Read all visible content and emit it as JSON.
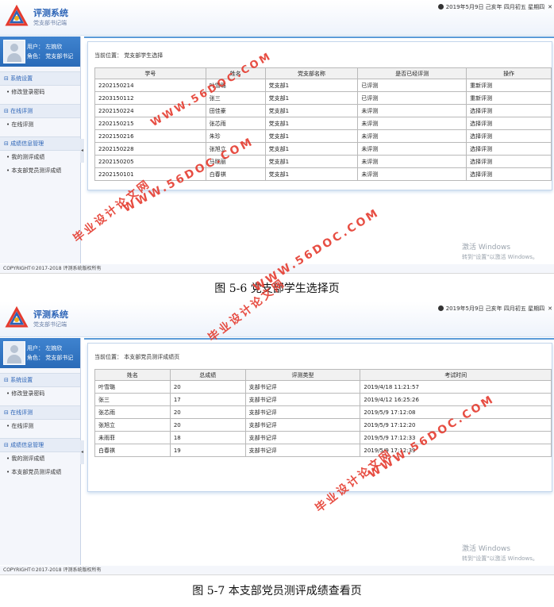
{
  "app": {
    "title": "评测系统",
    "subtitle": "党支部书记端",
    "date": "2019年5月9日 己亥年 四月初五 星期四"
  },
  "sidebar": {
    "user_label": "用户：  左婉欣",
    "role_label": "角色：  党支部书记",
    "groups": [
      {
        "label": "系统设置",
        "items": [
          "修改登录密码"
        ]
      },
      {
        "label": "在线评测",
        "items": [
          "在线评测"
        ]
      },
      {
        "label": "成绩信息管理",
        "items": [
          "我的测评成绩",
          "本支部党员测评成绩"
        ]
      }
    ]
  },
  "screen1": {
    "breadcrumb": "当前位置：  党支部学生选择",
    "columns": [
      "学号",
      "姓名",
      "党支部名称",
      "是否已经评测",
      "操作"
    ],
    "rows": [
      [
        "2202150214",
        "叶雪璐",
        "党支部1",
        "已评测",
        "重新评测"
      ],
      [
        "2203150112",
        "张三",
        "党支部1",
        "已评测",
        "重新评测"
      ],
      [
        "2202150224",
        "田佳豪",
        "党支部1",
        "未评测",
        "选择评测"
      ],
      [
        "2202150215",
        "张芯雨",
        "党支部1",
        "未评测",
        "选择评测"
      ],
      [
        "2202150216",
        "朱珍",
        "党支部1",
        "未评测",
        "选择评测"
      ],
      [
        "2202150228",
        "张旭立",
        "党支部1",
        "未评测",
        "选择评测"
      ],
      [
        "2202150205",
        "马晓丽",
        "党支部1",
        "未评测",
        "选择评测"
      ],
      [
        "2202150101",
        "白春祺",
        "党支部1",
        "未评测",
        "选择评测"
      ]
    ],
    "caption": "图 5-6 党支部学生选择页"
  },
  "screen2": {
    "breadcrumb": "当前位置：  本支部党员测评成绩页",
    "columns": [
      "姓名",
      "总成绩",
      "评测类型",
      "考试时间"
    ],
    "rows": [
      [
        "叶雪璐",
        "20",
        "支部书记评",
        "2019/4/18 11:21:57"
      ],
      [
        "张三",
        "17",
        "支部书记评",
        "2019/4/12 16:25:26"
      ],
      [
        "张芯雨",
        "20",
        "支部书记评",
        "2019/5/9 17:12:08"
      ],
      [
        "张旭立",
        "20",
        "支部书记评",
        "2019/5/9 17:12:20"
      ],
      [
        "未雨菲",
        "18",
        "支部书记评",
        "2019/5/9 17:12:33"
      ],
      [
        "白春祺",
        "19",
        "支部书记评",
        "2019/5/9 17:12:39"
      ]
    ],
    "caption": "图 5-7 本支部党员测评成绩查看页"
  },
  "footer": "COPYRIGHT©2017-2018 评测系统版权所有",
  "activate_windows": {
    "title": "激活 Windows",
    "sub": "转到\"设置\"以激活 Windows。"
  },
  "watermarks": [
    "WWW.56DOC.COM",
    "毕业设计论文网"
  ],
  "colors": {
    "accent": "#2b63b6",
    "watermark": "#e53b2f",
    "header_blue": "#3f83cf"
  }
}
